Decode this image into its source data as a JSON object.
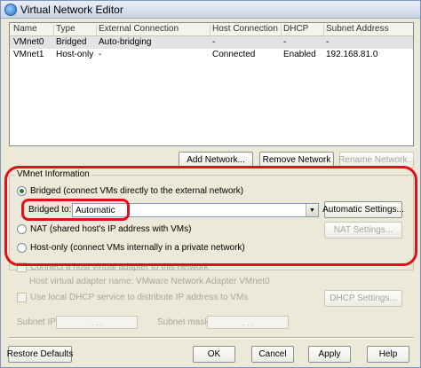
{
  "window": {
    "title": "Virtual Network Editor"
  },
  "table": {
    "columns": [
      "Name",
      "Type",
      "External Connection",
      "Host Connection",
      "DHCP",
      "Subnet Address"
    ],
    "rows": [
      [
        "VMnet0",
        "Bridged",
        "Auto-bridging",
        "-",
        "-",
        "-"
      ],
      [
        "VMnet1",
        "Host-only",
        "-",
        "Connected",
        "Enabled",
        "192.168.81.0"
      ]
    ]
  },
  "network_buttons": {
    "add": "Add Network...",
    "remove": "Remove Network",
    "rename": "Rename Network..."
  },
  "vmnet_info": {
    "legend": "VMnet Information",
    "bridged_label": "Bridged (connect VMs directly to the external network)",
    "bridged_to_label": "Bridged to:",
    "bridged_to_value": "Automatic",
    "automatic_settings": "Automatic Settings...",
    "nat_label": "NAT (shared host's IP address with VMs)",
    "nat_settings": "NAT Settings...",
    "hostonly_label": "Host-only (connect VMs internally in a private network)"
  },
  "adapter": {
    "connect_label": "Connect a host virtual adapter to this network",
    "adapter_name": "Host virtual adapter name: VMware Network Adapter VMnet0",
    "dhcp_label": "Use local DHCP service to distribute IP address to VMs",
    "dhcp_settings": "DHCP Settings..."
  },
  "subnet": {
    "ip_label": "Subnet IP:",
    "mask_label": "Subnet mask:",
    "ip_value": ". . .",
    "mask_value": ". . ."
  },
  "footer": {
    "restore": "Restore Defaults",
    "ok": "OK",
    "cancel": "Cancel",
    "apply": "Apply",
    "help": "Help"
  },
  "colors": {
    "annotation": "#e0101a",
    "selection": "#e3e3e3"
  }
}
